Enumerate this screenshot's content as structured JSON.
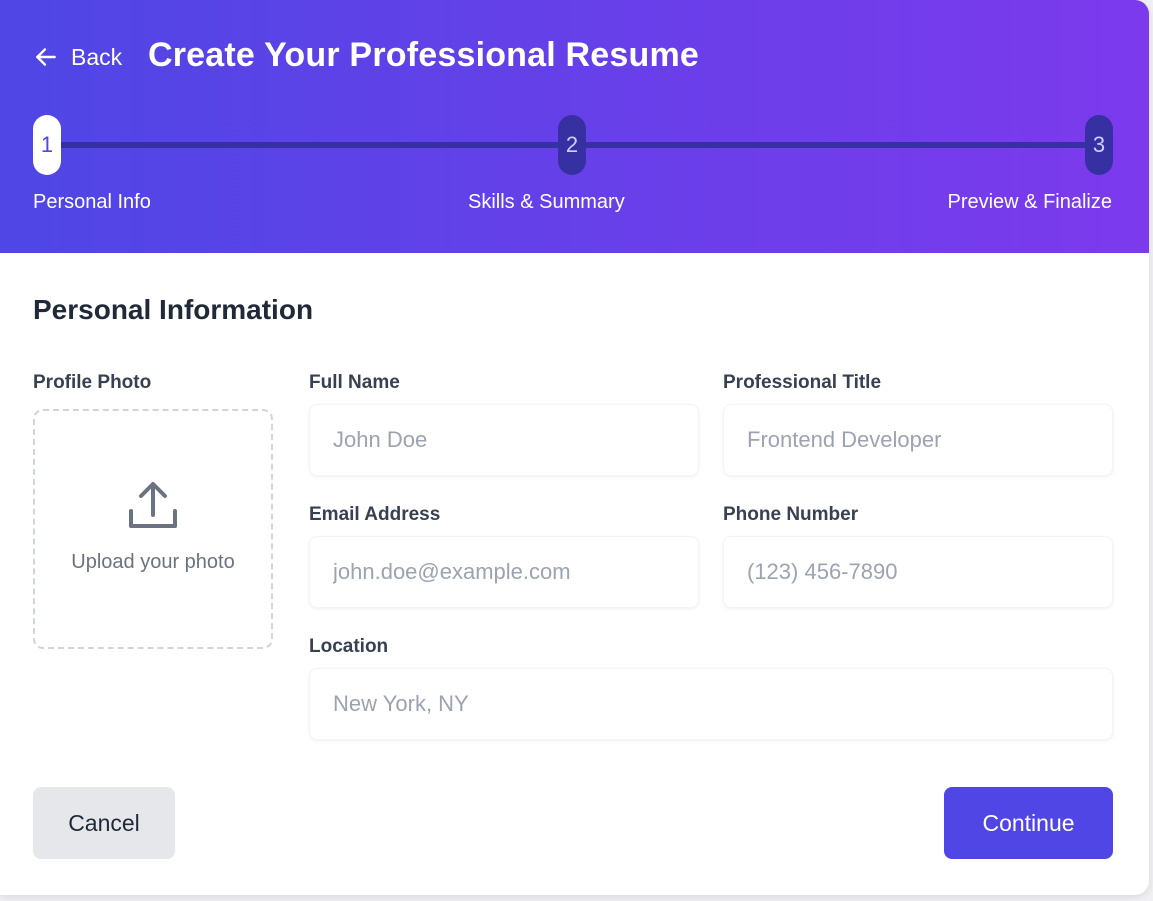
{
  "header": {
    "back_label": "Back",
    "title": "Create Your Professional Resume",
    "gradient_start": "#4f46e5",
    "gradient_end": "#7c3aed"
  },
  "steps": [
    {
      "number": "1",
      "label": "Personal Info",
      "state": "active"
    },
    {
      "number": "2",
      "label": "Skills & Summary",
      "state": "upcoming"
    },
    {
      "number": "3",
      "label": "Preview & Finalize",
      "state": "upcoming"
    }
  ],
  "section": {
    "title": "Personal Information"
  },
  "photo": {
    "label": "Profile Photo",
    "upload_text": "Upload your photo",
    "icon": "upload-icon"
  },
  "fields": {
    "full_name": {
      "label": "Full Name",
      "placeholder": "John Doe",
      "value": ""
    },
    "professional_title": {
      "label": "Professional Title",
      "placeholder": "Frontend Developer",
      "value": ""
    },
    "email": {
      "label": "Email Address",
      "placeholder": "john.doe@example.com",
      "value": ""
    },
    "phone": {
      "label": "Phone Number",
      "placeholder": "(123) 456-7890",
      "value": ""
    },
    "location": {
      "label": "Location",
      "placeholder": "New York, NY",
      "value": ""
    }
  },
  "actions": {
    "cancel_label": "Cancel",
    "continue_label": "Continue",
    "primary_color": "#4f46e5"
  }
}
